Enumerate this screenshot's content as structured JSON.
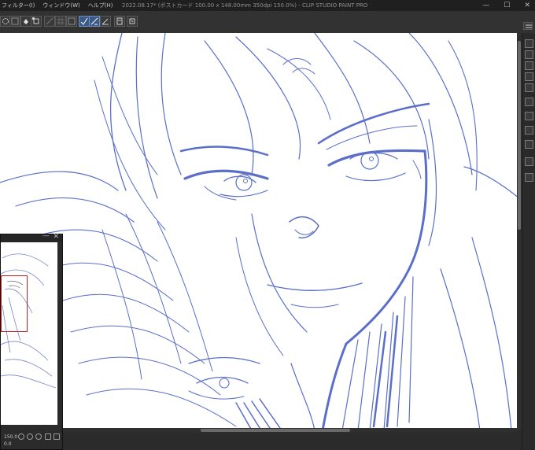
{
  "menu": {
    "items": [
      "フィルター(I)",
      "ウィンドウ(W)",
      "ヘルプ(H)"
    ]
  },
  "window": {
    "title": "2022.08.17* (ポストカード 100.00 x 148.00mm 350dpi 150.0%) - CLIP STUDIO PAINT PRO"
  },
  "window_controls": {
    "minimize": "—",
    "maximize": "☐",
    "close": "✕"
  },
  "navigator": {
    "zoom": "150.0",
    "rotation": "0.0",
    "close": "✕",
    "minimize": "—"
  },
  "colors": {
    "line_art": "#5b6fc8",
    "frame": "#c0201f",
    "active_tool": "#3c5a86"
  },
  "icons": [
    "lasso-icon",
    "selection-icon",
    "fill-icon",
    "transform-icon",
    "ruler-icon",
    "pen-icon",
    "pencil-icon",
    "brush-icon",
    "layer-icon",
    "history-icon",
    "navigator-icon"
  ]
}
